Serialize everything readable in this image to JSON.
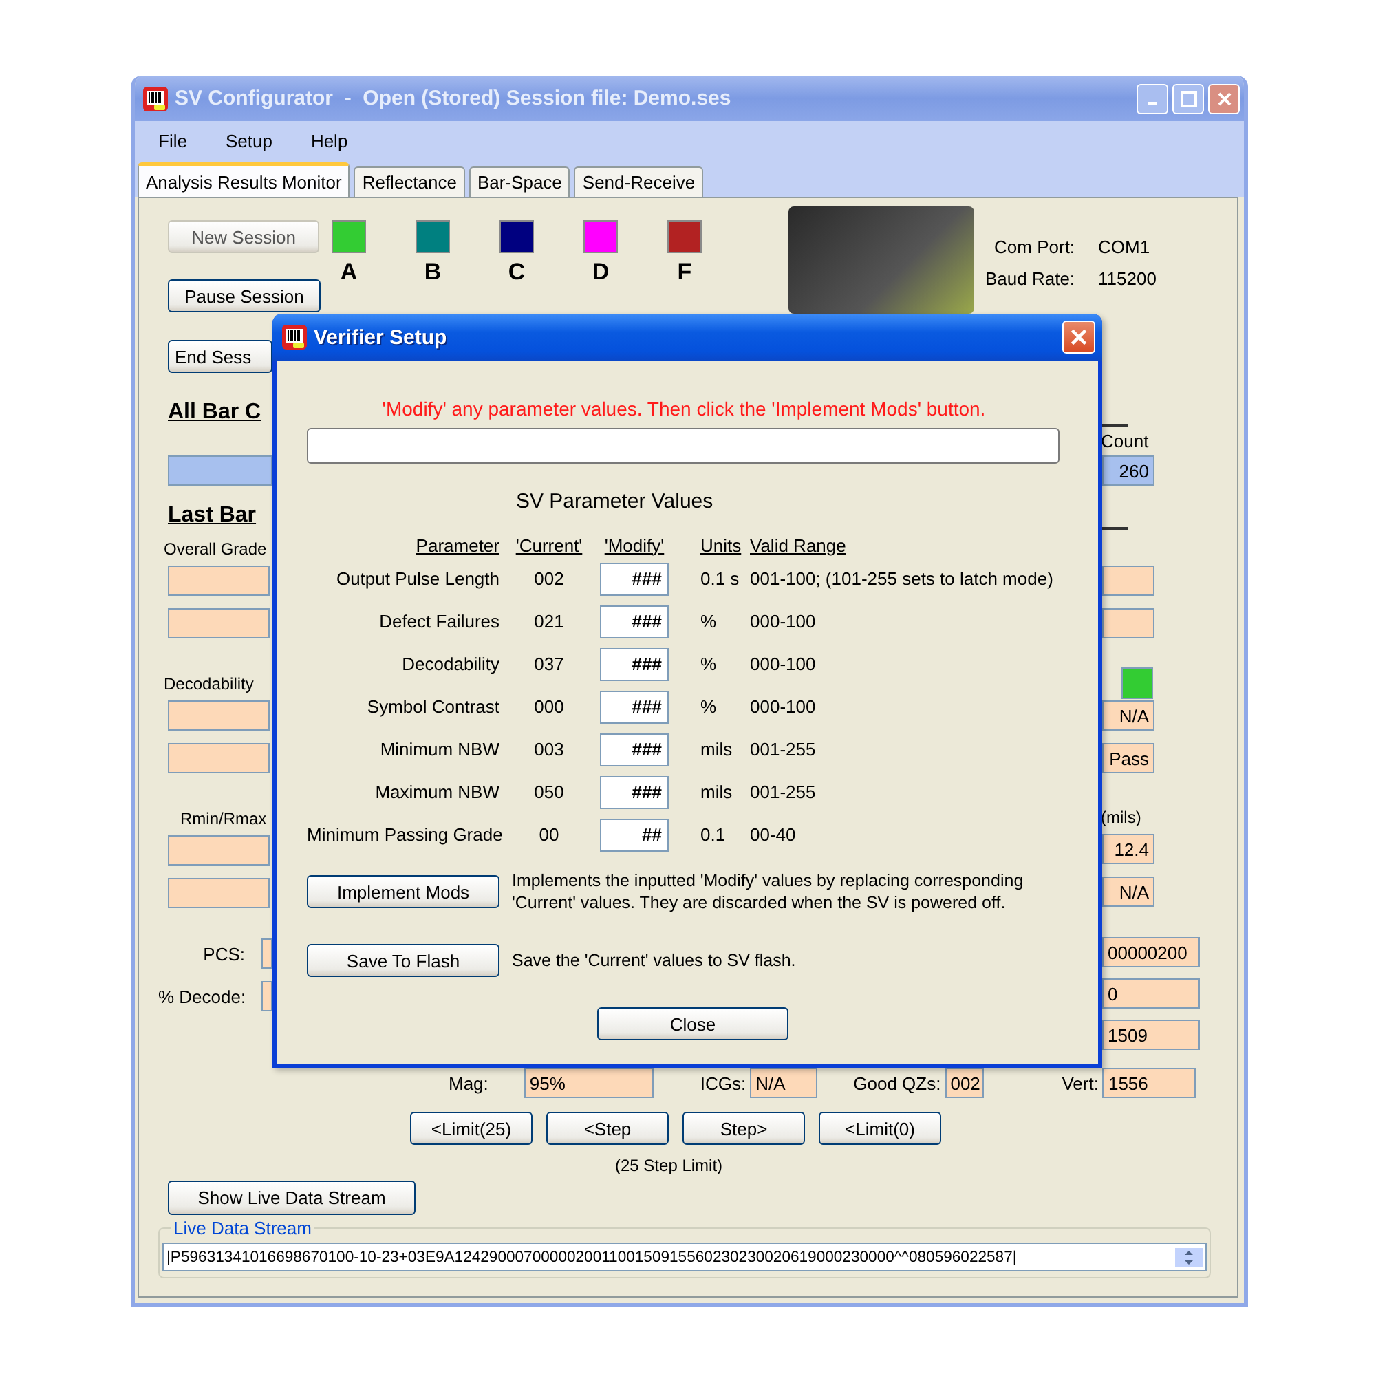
{
  "window": {
    "title": "SV Configurator  -  Open (Stored) Session file: Demo.ses"
  },
  "menu": [
    "File",
    "Setup",
    "Help"
  ],
  "tabs": [
    {
      "label": "Analysis Results Monitor",
      "selected": true
    },
    {
      "label": "Reflectance",
      "selected": false
    },
    {
      "label": "Bar-Space",
      "selected": false
    },
    {
      "label": "Send-Receive",
      "selected": false
    }
  ],
  "session_buttons": [
    {
      "label": "New Session",
      "disabled": true
    },
    {
      "label": "Pause Session",
      "disabled": false
    },
    {
      "label": "End Sess",
      "disabled": false
    }
  ],
  "grade_swatches": [
    {
      "label": "A",
      "color": "#33cc33"
    },
    {
      "label": "B",
      "color": "#008080"
    },
    {
      "label": "C",
      "color": "#000080"
    },
    {
      "label": "D",
      "color": "#ff00ff"
    },
    {
      "label": "F",
      "color": "#b22222"
    }
  ],
  "connection": [
    {
      "label": "Com Port:",
      "value": "COM1"
    },
    {
      "label": "Baud Rate:",
      "value": "115200"
    }
  ],
  "left_column": [
    {
      "kind": "heading",
      "text": "All Bar C"
    },
    {
      "kind": "bar"
    },
    {
      "kind": "heading",
      "text": "Last Bar"
    },
    {
      "kind": "label",
      "text": "Overall Grade"
    },
    {
      "kind": "field"
    },
    {
      "kind": "field"
    },
    {
      "kind": "label",
      "text": "Decodability"
    },
    {
      "kind": "field"
    },
    {
      "kind": "field"
    },
    {
      "kind": "label",
      "text": "Rmin/Rmax"
    },
    {
      "kind": "field"
    },
    {
      "kind": "field"
    },
    {
      "kind": "labeled_field",
      "text": "PCS:"
    },
    {
      "kind": "labeled_field",
      "text": "% Decode:"
    }
  ],
  "right_column": [
    {
      "kind": "header",
      "text": "Count"
    },
    {
      "kind": "count",
      "text": "260"
    },
    {
      "kind": "rule"
    },
    {
      "kind": "field"
    },
    {
      "kind": "field"
    },
    {
      "kind": "indicator",
      "color": "#33cc33"
    },
    {
      "kind": "field",
      "text": "N/A"
    },
    {
      "kind": "field",
      "text": "Pass"
    },
    {
      "kind": "label",
      "text": "(mils)"
    },
    {
      "kind": "field",
      "text": "12.4"
    },
    {
      "kind": "field",
      "text": "N/A"
    },
    {
      "kind": "wide_field",
      "text": "00000200"
    },
    {
      "kind": "wide_field",
      "text": "0"
    },
    {
      "kind": "wide_field",
      "text": "1509"
    }
  ],
  "readouts": [
    {
      "label": "Mag:",
      "value": "95%"
    },
    {
      "label": "ICGs:",
      "value": "N/A"
    },
    {
      "label": "Good QZs:",
      "value": "002"
    },
    {
      "label": "Vert:",
      "value": "1556"
    }
  ],
  "step_buttons": [
    "<Limit(25)",
    "<Step",
    "Step>",
    "<Limit(0)"
  ],
  "step_note": "(25 Step Limit)",
  "live_button": "Show Live Data Stream",
  "live_stream": {
    "legend": "Live Data Stream",
    "value": "|P59631341016698670100-10-23+03E9A124290007000002001100150915560230230020619000230000^^080596022587|"
  },
  "dialog": {
    "title": "Verifier Setup",
    "message": "'Modify' any parameter values. Then click the 'Implement Mods' button.",
    "section_title": "SV Parameter Values",
    "columns": [
      "Parameter",
      "'Current'",
      "'Modify'",
      "Units",
      "Valid Range"
    ],
    "rows": [
      {
        "name": "Output Pulse Length",
        "current": "002",
        "modify": "###",
        "units": "0.1 s",
        "range": "001-100;  (101-255 sets to latch mode)"
      },
      {
        "name": "Defect Failures",
        "current": "021",
        "modify": "###",
        "units": "%",
        "range": "000-100"
      },
      {
        "name": "Decodability",
        "current": "037",
        "modify": "###",
        "units": "%",
        "range": "000-100"
      },
      {
        "name": "Symbol Contrast",
        "current": "000",
        "modify": "###",
        "units": "%",
        "range": "000-100"
      },
      {
        "name": "Minimum NBW",
        "current": "003",
        "modify": "###",
        "units": "mils",
        "range": "001-255"
      },
      {
        "name": "Maximum NBW",
        "current": "050",
        "modify": "###",
        "units": "mils",
        "range": "001-255"
      },
      {
        "name": "Minimum Passing Grade",
        "current": "00",
        "modify": "##",
        "units": "0.1",
        "range": "00-40"
      }
    ],
    "actions": [
      {
        "label": "Implement Mods",
        "description": "Implements the inputted 'Modify' values by replacing corresponding 'Current' values. They are discarded when the SV is powered off."
      },
      {
        "label": "Save To Flash",
        "description": "Save the 'Current' values to SV flash."
      }
    ],
    "close": "Close"
  }
}
